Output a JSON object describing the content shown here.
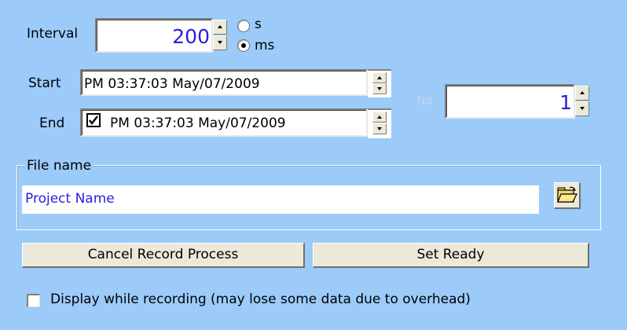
{
  "interval": {
    "label": "Interval",
    "value": "200",
    "units": [
      {
        "label": "s",
        "selected": false
      },
      {
        "label": "ms",
        "selected": true
      }
    ]
  },
  "start": {
    "label": "Start",
    "value": "PM 03:37:03  May/07/2009"
  },
  "end": {
    "label": "End",
    "enabled": true,
    "value": "PM 03:37:03  May/07/2009"
  },
  "no": {
    "label": "No",
    "value": "1"
  },
  "file": {
    "group_label": "File name",
    "value": "Project Name",
    "browse_icon": "folder-open-icon"
  },
  "buttons": {
    "cancel": "Cancel Record Process",
    "ready": "Set Ready"
  },
  "display_option": {
    "label": "Display while recording (may lose some data due to overhead)",
    "checked": false
  },
  "colors": {
    "background": "#9ccbfa",
    "value_text": "#2b1dd6",
    "disabled_label": "#c8d4e4",
    "button_face": "#ece9d8"
  }
}
